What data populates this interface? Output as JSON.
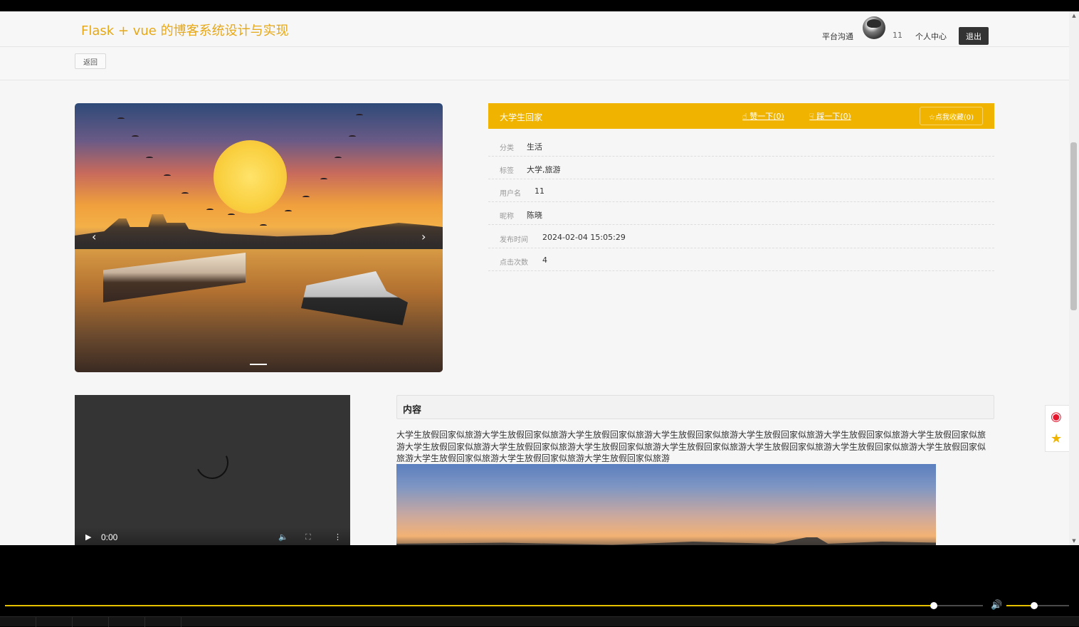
{
  "header": {
    "site_title": "Flask + vue 的博客系统设计与实现",
    "nav_chat": "平台沟通",
    "username": "11",
    "nav_profile": "个人中心",
    "logout": "退出"
  },
  "subbar": {
    "back": "返回"
  },
  "carousel": {
    "prev": "‹",
    "next": "›"
  },
  "info": {
    "title": "大学生回家",
    "like": "赞一下(0)",
    "dislike": "踩一下(0)",
    "favorite": "☆点我收藏(0)",
    "rows": [
      {
        "label": "分类",
        "value": "生活"
      },
      {
        "label": "标签",
        "value": "大学,旅游"
      },
      {
        "label": "用户名",
        "value": "11"
      },
      {
        "label": "昵称",
        "value": "陈晓"
      },
      {
        "label": "发布时间",
        "value": "2024-02-04 15:05:29"
      },
      {
        "label": "点击次数",
        "value": "4"
      }
    ]
  },
  "video": {
    "time": "0:00"
  },
  "content": {
    "heading": "内容",
    "text": "大学生放假回家似旅游大学生放假回家似旅游大学生放假回家似旅游大学生放假回家似旅游大学生放假回家似旅游大学生放假回家似旅游大学生放假回家似旅游大学生放假回家似旅游大学生放假回家似旅游大学生放假回家似旅游大学生放假回家似旅游大学生放假回家似旅游大学生放假回家似旅游大学生放假回家似旅游大学生放假回家似旅游大学生放假回家似旅游大学生放假回家似旅游"
  },
  "colors": {
    "accent": "#f0b400",
    "title": "#e6a817",
    "progress": "#e6c100"
  },
  "icons": [
    "thumbs-up-icon",
    "thumbs-down-icon",
    "star-icon",
    "weibo-icon",
    "play-icon",
    "volume-icon",
    "fullscreen-icon",
    "more-icon"
  ]
}
